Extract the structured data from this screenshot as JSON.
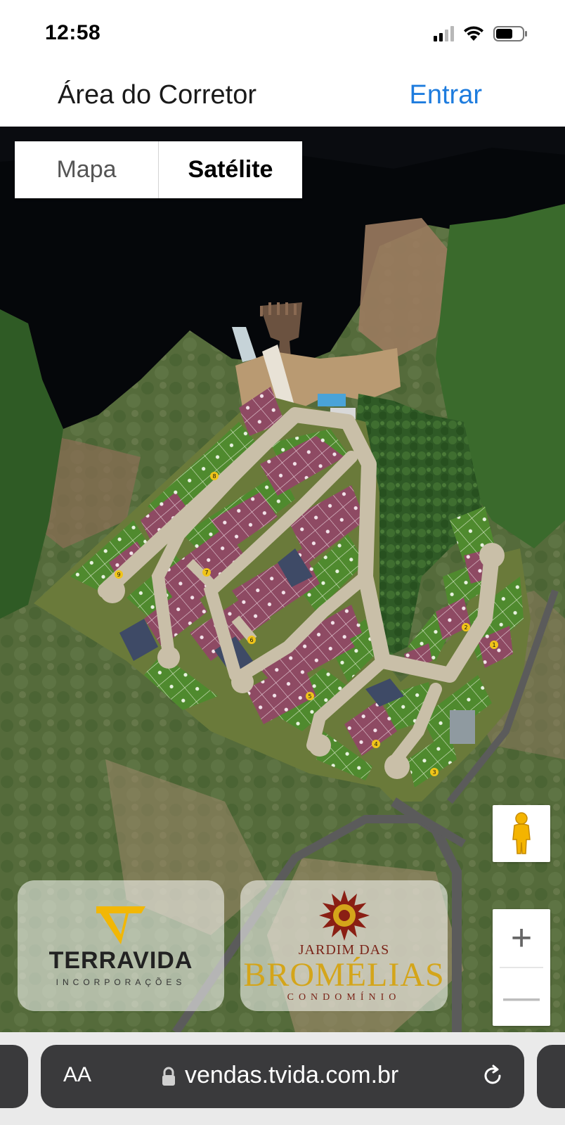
{
  "status_bar": {
    "time": "12:58"
  },
  "header": {
    "title": "Área do Corretor",
    "login_label": "Entrar"
  },
  "map": {
    "type_toggle": {
      "map_label": "Mapa",
      "satellite_label": "Satélite",
      "selected": "Satélite"
    },
    "lot_block_numbers": [
      "1",
      "2",
      "3",
      "4",
      "5",
      "6",
      "7",
      "8",
      "9"
    ],
    "zoom_in_label": "+",
    "zoom_out_label": "—",
    "legend_colors": {
      "available": "#4f8a2e",
      "sold": "#8e4a63",
      "reserved": "#3e4a66",
      "road": "#c9bfa8"
    }
  },
  "logos": {
    "terravida": {
      "name": "TERRAVIDA",
      "subtitle": "INCORPORAÇÕES",
      "color": "#f2b705"
    },
    "bromelias": {
      "line1": "JARDIM DAS",
      "line2": "BROMÉLIAS",
      "line3": "CONDOMÍNIO"
    }
  },
  "browser": {
    "aa_label": "AA",
    "url": "vendas.tvida.com.br"
  }
}
